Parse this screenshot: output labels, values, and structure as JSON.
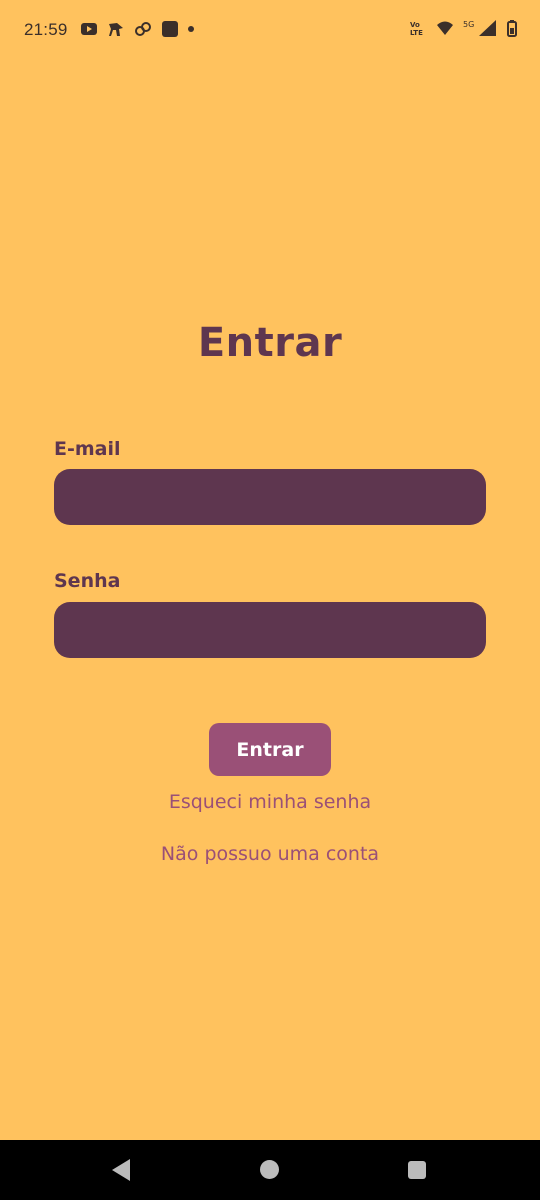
{
  "status_bar": {
    "time": "21:59",
    "network_label": "5G",
    "volte_label": "Vo LTE"
  },
  "login": {
    "title": "Entrar",
    "email_label": "E-mail",
    "email_value": "",
    "password_label": "Senha",
    "password_value": "",
    "submit_label": "Entrar",
    "forgot_password": "Esqueci minha senha",
    "no_account": "Não possuo uma conta"
  },
  "colors": {
    "background": "#FFC25E",
    "primary_dark": "#5E364F",
    "accent": "#9A5077"
  }
}
